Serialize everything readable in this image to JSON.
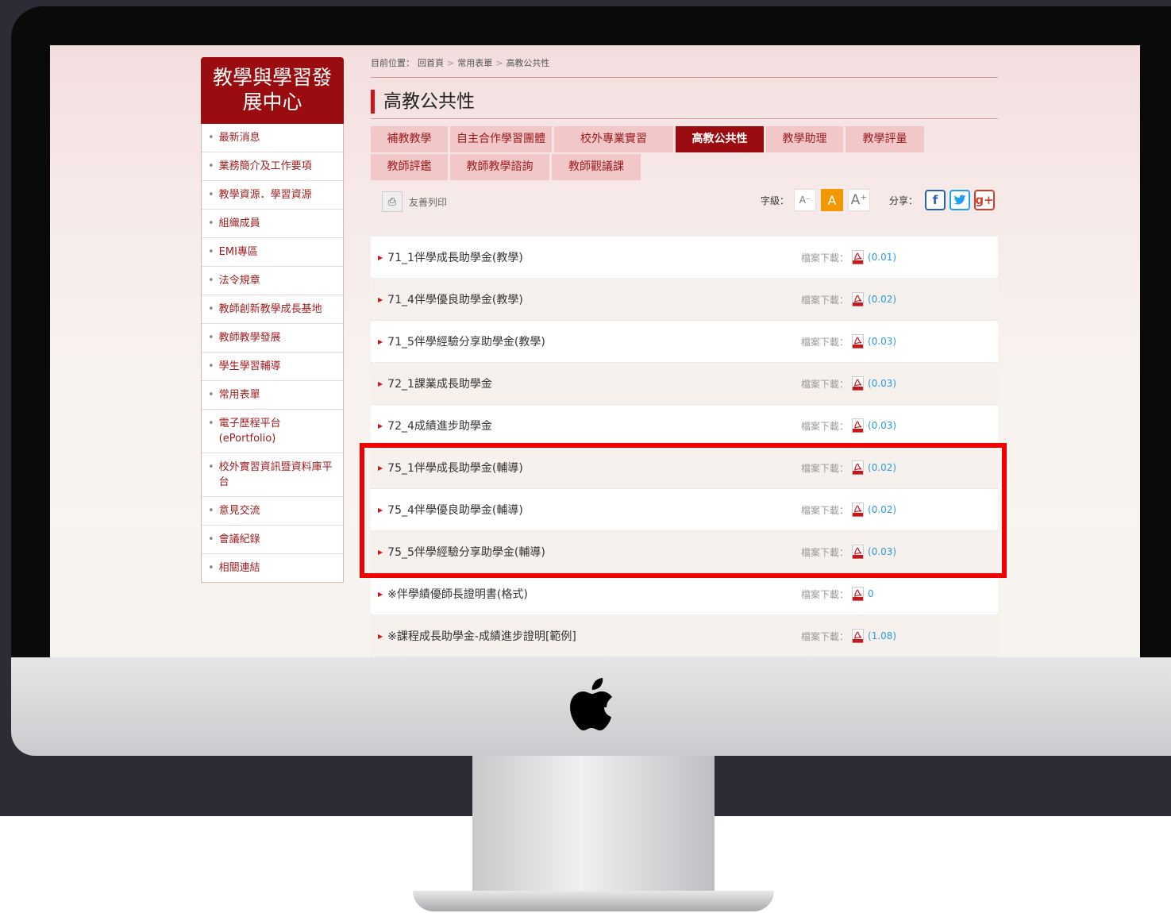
{
  "sidebar": {
    "title": "教學與學習發展中心",
    "items": [
      {
        "label": "最新消息"
      },
      {
        "label": "業務簡介及工作要項"
      },
      {
        "label": "教學資源．學習資源"
      },
      {
        "label": "組織成員"
      },
      {
        "label": "EMI專區"
      },
      {
        "label": "法令規章"
      },
      {
        "label": "教師創新教學成長基地"
      },
      {
        "label": "教師教學發展"
      },
      {
        "label": "學生學習輔導"
      },
      {
        "label": "常用表單"
      },
      {
        "label": "電子歷程平台(ePortfolio)"
      },
      {
        "label": "校外實習資訊暨資料庫平台"
      },
      {
        "label": "意見交流"
      },
      {
        "label": "會議紀錄"
      },
      {
        "label": "相關連結"
      }
    ]
  },
  "breadcrumb": {
    "prefix": "目前位置：",
    "items": [
      "回首頁",
      "常用表單",
      "高教公共性"
    ],
    "sep": ">"
  },
  "page": {
    "title": "高教公共性"
  },
  "tabs": [
    {
      "label": "補教教學",
      "active": false
    },
    {
      "label": "自主合作學習團體",
      "active": false
    },
    {
      "label": "校外專業實習",
      "active": false
    },
    {
      "label": "高教公共性",
      "active": true
    },
    {
      "label": "教學助理",
      "active": false
    },
    {
      "label": "教學評量",
      "active": false
    },
    {
      "label": "教師評鑑",
      "active": false
    },
    {
      "label": "教師教學諮詢",
      "active": false
    },
    {
      "label": "教師觀議課",
      "active": false
    }
  ],
  "toolbar": {
    "print_label": "友善列印",
    "font_size_label": "字級：",
    "font_small": "A⁻",
    "font_normal": "A",
    "font_large": "A⁺",
    "share_label": "分享：",
    "facebook": "f",
    "twitter": "t",
    "googleplus": "g+"
  },
  "files": [
    {
      "name": "71_1伴學成長助學金(教學)",
      "dl_label": "檔案下載：",
      "size": "(0.01)"
    },
    {
      "name": "71_4伴學優良助學金(教學)",
      "dl_label": "檔案下載：",
      "size": "(0.02)"
    },
    {
      "name": "71_5伴學經驗分享助學金(教學)",
      "dl_label": "檔案下載：",
      "size": "(0.03)"
    },
    {
      "name": "72_1課業成長助學金",
      "dl_label": "檔案下載：",
      "size": "(0.03)"
    },
    {
      "name": "72_4成績進步助學金",
      "dl_label": "檔案下載：",
      "size": "(0.03)"
    },
    {
      "name": "75_1伴學成長助學金(輔導)",
      "dl_label": "檔案下載：",
      "size": "(0.02)"
    },
    {
      "name": "75_4伴學優良助學金(輔導)",
      "dl_label": "檔案下載：",
      "size": "(0.02)"
    },
    {
      "name": "75_5伴學經驗分享助學金(輔導)",
      "dl_label": "檔案下載：",
      "size": "(0.03)"
    },
    {
      "name": "※伴學績優師長證明書(格式)",
      "dl_label": "檔案下載：",
      "size": "0"
    },
    {
      "name": "※課程成長助學金-成績進步證明[範例]",
      "dl_label": "檔案下載：",
      "size": "(1.08)"
    }
  ],
  "colors": {
    "brand": "#9b0c10",
    "highlight": "#f00000",
    "link": "#2a9ad8",
    "font_active": "#f29700"
  },
  "icons": [
    "printer-icon",
    "pdf-icon",
    "facebook-icon",
    "twitter-icon",
    "googleplus-icon",
    "apple-logo-icon"
  ]
}
